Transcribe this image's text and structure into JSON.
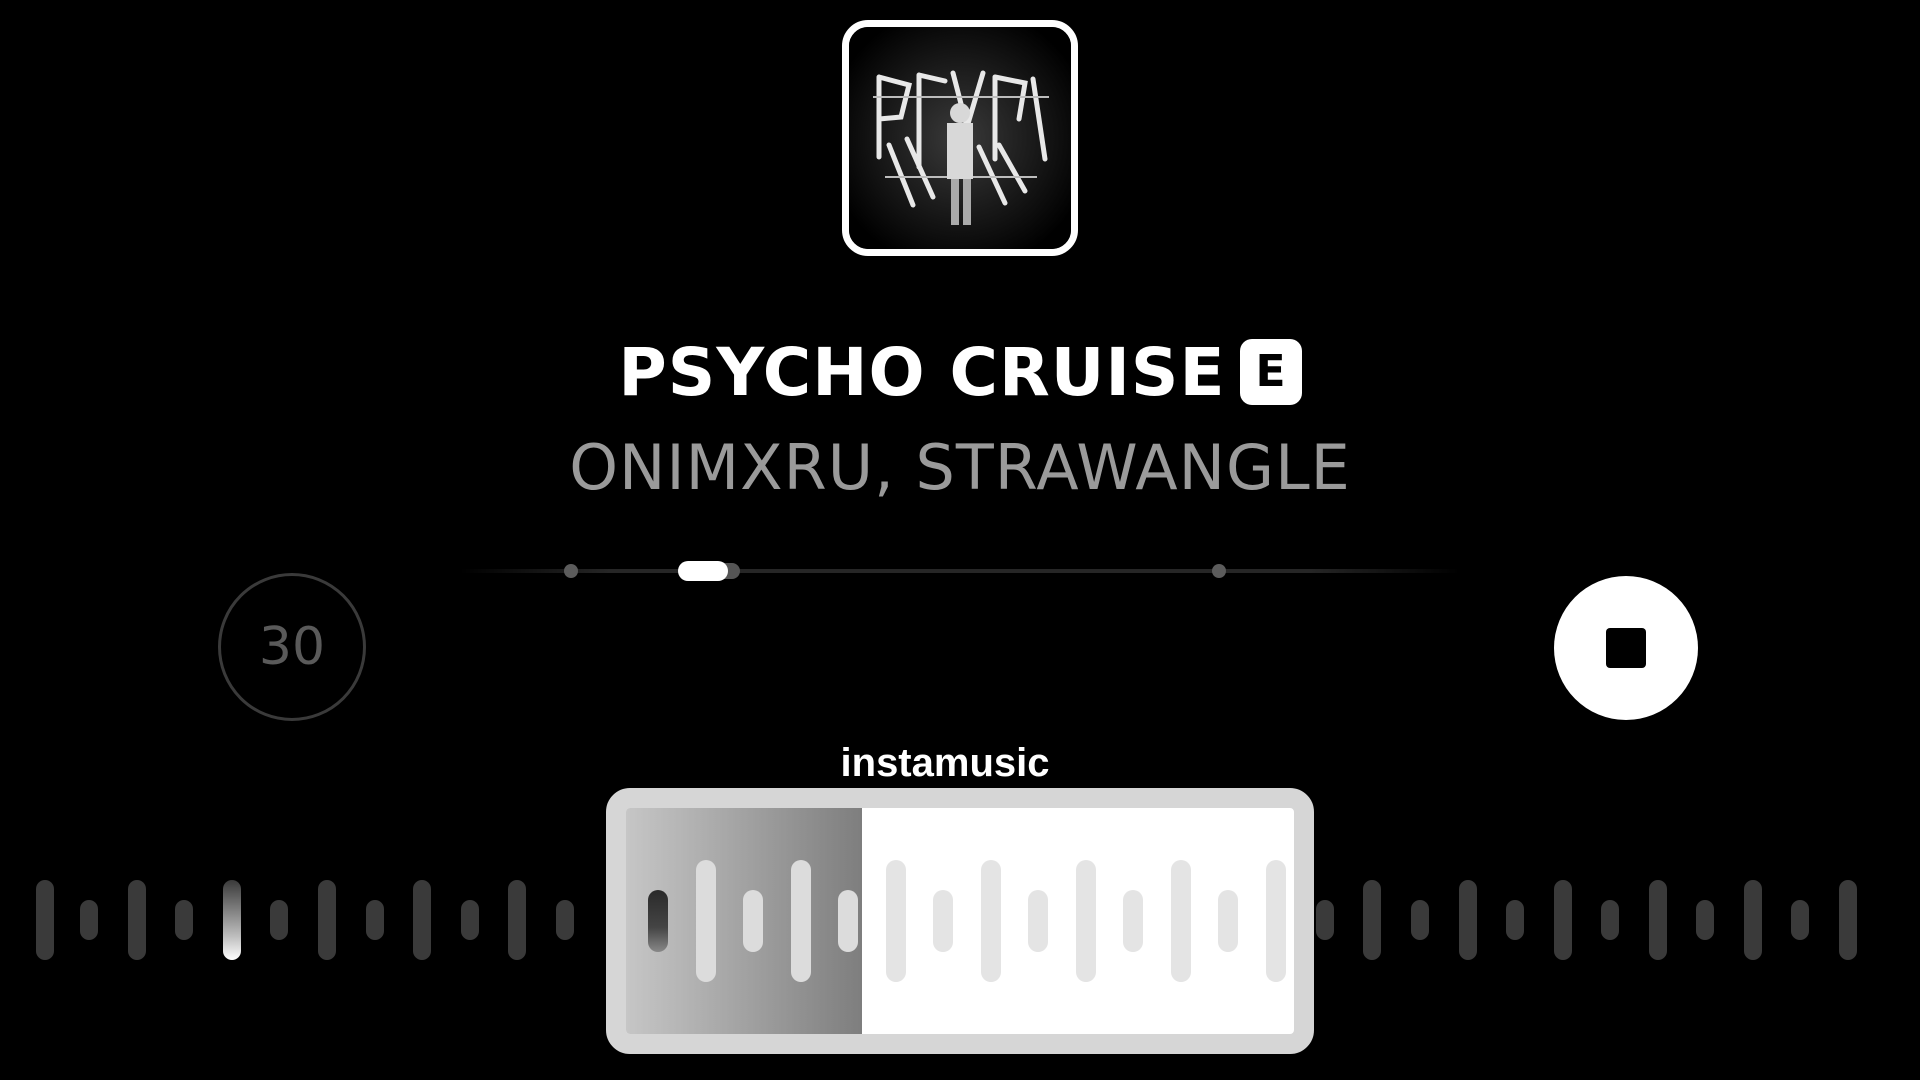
{
  "track": {
    "title": "PSYCHO CRUISE",
    "explicit_badge": "E",
    "artists": "ONIMXRU, STRAWANGLE"
  },
  "album_art": {
    "icon": "album-cover-image"
  },
  "controls": {
    "skip_seconds_label": "30",
    "stop_icon": "stop-icon"
  },
  "watermark": "instamusic",
  "colors": {
    "background": "#000000",
    "foreground": "#ffffff",
    "artist_text": "#9a9a9a",
    "inactive_bar": "#3a3a3a",
    "selection_border": "#d6d6d6"
  }
}
